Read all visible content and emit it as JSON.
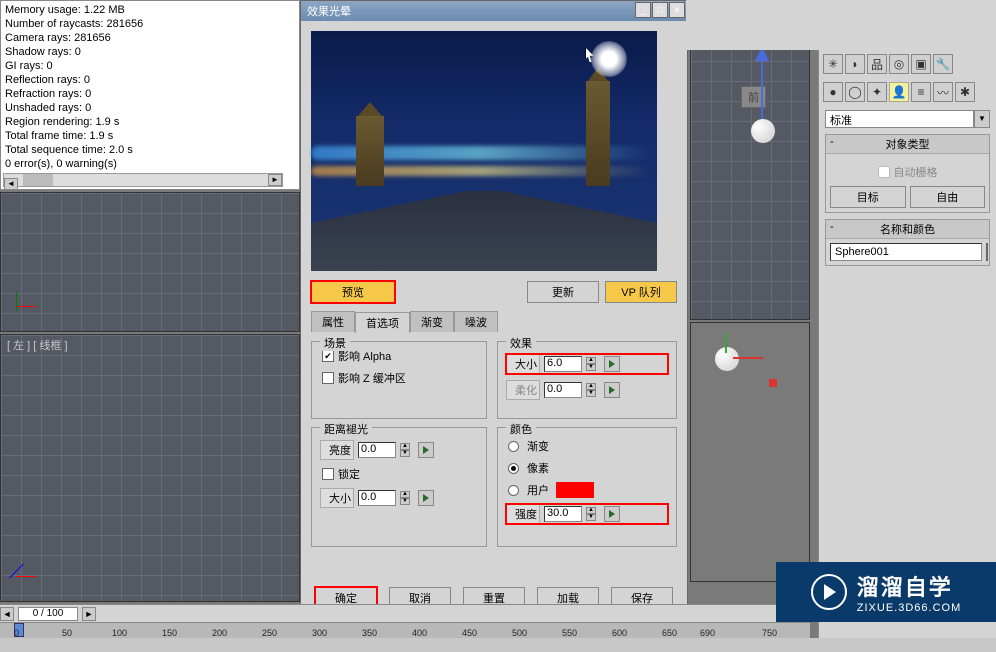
{
  "stats": {
    "lines": [
      "Memory usage: 1.22 MB",
      "Number of raycasts: 281656",
      "  Camera rays: 281656",
      "  Shadow rays: 0",
      "  GI rays: 0",
      "  Reflection rays: 0",
      "  Refraction rays: 0",
      "  Unshaded rays: 0",
      "Region rendering: 1.9 s",
      "Total frame time: 1.9 s",
      "Total sequence time: 2.0 s",
      "0 error(s), 0 warning(s)"
    ]
  },
  "viewport": {
    "left_label": "[ 左 ] [ 线框 ]",
    "front_label": "前"
  },
  "dialog": {
    "title": "效果光晕",
    "btn_preview": "预览",
    "btn_update": "更新",
    "btn_vpqueue": "VP 队列",
    "tabs": {
      "t1": "属性",
      "t2": "首选项",
      "t3": "渐变",
      "t4": "噪波"
    },
    "scene": {
      "legend": "场景",
      "affect_alpha": "影响 Alpha",
      "affect_z": "影响 Z 缓冲区"
    },
    "effect": {
      "legend": "效果",
      "size_label": "大小",
      "size_value": "6.0",
      "soften_label": "柔化",
      "soften_value": "0.0"
    },
    "distance": {
      "legend": "距离褪光",
      "bright_label": "亮度",
      "bright_value": "0.0",
      "lock_label": "锁定",
      "size_label": "大小",
      "size_value": "0.0"
    },
    "color": {
      "legend": "颜色",
      "opt_gradient": "渐变",
      "opt_pixel": "像素",
      "opt_user": "用户",
      "intensity_label": "强度",
      "intensity_value": "30.0"
    },
    "bottom": {
      "ok": "确定",
      "cancel": "取消",
      "reset": "重置",
      "load": "加载",
      "save": "保存"
    }
  },
  "cmdpanel": {
    "dropdown": "标准",
    "rollout_object": "对象类型",
    "auto_grid": "自动栅格",
    "btn_target": "目标",
    "btn_free": "自由",
    "rollout_name": "名称和颜色",
    "object_name": "Sphere001"
  },
  "timeline": {
    "frame": "0 / 100",
    "ticks": [
      "0",
      "50",
      "100",
      "150",
      "200",
      "250",
      "300",
      "350",
      "400",
      "450",
      "500",
      "550",
      "600",
      "650",
      "690",
      "750",
      "100"
    ]
  },
  "watermark": {
    "brand": "溜溜自学",
    "url": "ZIXUE.3D66.COM"
  }
}
